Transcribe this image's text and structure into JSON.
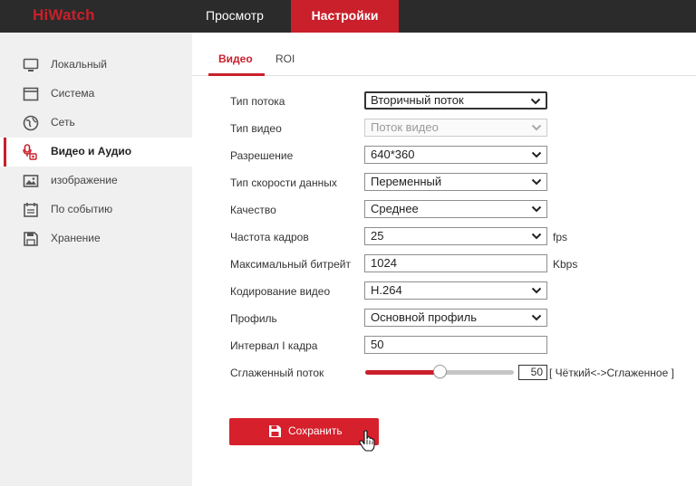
{
  "app": {
    "logo": "HiWatch",
    "nav": {
      "view": "Просмотр",
      "settings": "Настройки"
    }
  },
  "sidebar": {
    "items": [
      {
        "label": "Локальный",
        "icon": "monitor-icon",
        "active": false
      },
      {
        "label": "Система",
        "icon": "system-window-icon",
        "active": false
      },
      {
        "label": "Сеть",
        "icon": "globe-icon",
        "active": false
      },
      {
        "label": "Видео и Аудио",
        "icon": "microphone-camera-icon",
        "active": true
      },
      {
        "label": "изображение",
        "icon": "image-icon",
        "active": false
      },
      {
        "label": "По событию",
        "icon": "calendar-icon",
        "active": false
      },
      {
        "label": "Хранение",
        "icon": "floppy-disk-icon",
        "active": false
      }
    ]
  },
  "tabs": {
    "video": "Видео",
    "roi": "ROI"
  },
  "form": {
    "stream_type": {
      "label": "Тип потока",
      "value": "Вторичный поток"
    },
    "video_type": {
      "label": "Тип видео",
      "value": "Поток видео"
    },
    "resolution": {
      "label": "Разрешение",
      "value": "640*360"
    },
    "bitrate_type": {
      "label": "Тип скорости данных",
      "value": "Переменный"
    },
    "quality": {
      "label": "Качество",
      "value": "Среднее"
    },
    "frame_rate": {
      "label": "Частота кадров",
      "value": "25",
      "unit": "fps"
    },
    "max_bitrate": {
      "label": "Максимальный битрейт",
      "value": "1024",
      "unit": "Kbps"
    },
    "encoding": {
      "label": "Кодирование видео",
      "value": "H.264"
    },
    "profile": {
      "label": "Профиль",
      "value": "Основной профиль"
    },
    "i_frame": {
      "label": "Интервал I кадра",
      "value": "50"
    },
    "smoothing": {
      "label": "Сглаженный поток",
      "value": "50",
      "level": 0.5,
      "range_text": "[ Чёткий<->Сглаженное ]"
    }
  },
  "save": {
    "label": "Сохранить"
  },
  "colors": {
    "accent": "#c9202b",
    "topbar": "#2b2b2b",
    "sidebar": "#f0f0f0"
  }
}
